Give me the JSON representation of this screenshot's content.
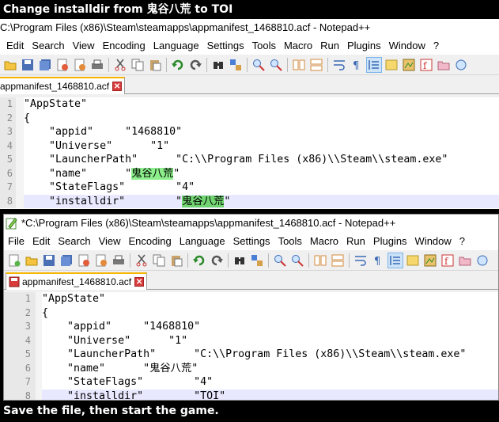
{
  "caption_top": {
    "prefix": "Change installdir from ",
    "from": "鬼谷八荒",
    "middle": " to ",
    "to": "TOI"
  },
  "caption_bottom": "Save the file, then start the game.",
  "window1": {
    "title": "C:\\Program Files (x86)\\Steam\\steamapps\\appmanifest_1468810.acf - Notepad++",
    "menu": [
      "Edit",
      "Search",
      "View",
      "Encoding",
      "Language",
      "Settings",
      "Tools",
      "Macro",
      "Run",
      "Plugins",
      "Window",
      "?"
    ],
    "tab_label": "appmanifest_1468810.acf",
    "lines": [
      {
        "num": "1",
        "text": "\"AppState\""
      },
      {
        "num": "2",
        "text": "{"
      },
      {
        "num": "3",
        "text": "    \"appid\"     \"1468810\""
      },
      {
        "num": "4",
        "text": "    \"Universe\"      \"1\""
      },
      {
        "num": "5",
        "text": "    \"LauncherPath\"      \"C:\\\\Program Files (x86)\\\\Steam\\\\steam.exe\""
      },
      {
        "num": "6",
        "text_before": "    \"name\"      \"",
        "highlight": "鬼谷八荒",
        "text_after": "\""
      },
      {
        "num": "7",
        "text": "    \"StateFlags\"        \"4\""
      },
      {
        "num": "8",
        "text_before": "    \"installdir\"        \"",
        "highlight": "鬼谷八荒",
        "text_after": "\""
      }
    ]
  },
  "window2": {
    "title": "*C:\\Program Files (x86)\\Steam\\steamapps\\appmanifest_1468810.acf - Notepad++",
    "menu": [
      "File",
      "Edit",
      "Search",
      "View",
      "Encoding",
      "Language",
      "Settings",
      "Tools",
      "Macro",
      "Run",
      "Plugins",
      "Window",
      "?"
    ],
    "tab_label": "appmanifest_1468810.acf",
    "lines": [
      {
        "num": "1",
        "text": "\"AppState\""
      },
      {
        "num": "2",
        "text": "{"
      },
      {
        "num": "3",
        "text": "    \"appid\"     \"1468810\""
      },
      {
        "num": "4",
        "text": "    \"Universe\"      \"1\""
      },
      {
        "num": "5",
        "text": "    \"LauncherPath\"      \"C:\\\\Program Files (x86)\\\\Steam\\\\steam.exe\""
      },
      {
        "num": "6",
        "text": "    \"name\"      \"鬼谷八荒\""
      },
      {
        "num": "7",
        "text": "    \"StateFlags\"        \"4\""
      },
      {
        "num": "8",
        "text": "    \"installdir\"        \"TOI\""
      }
    ]
  },
  "colors": {
    "highlight_green": "#8cef8c",
    "current_line": "#e8e8ff",
    "tab_accent": "#f7b500"
  }
}
